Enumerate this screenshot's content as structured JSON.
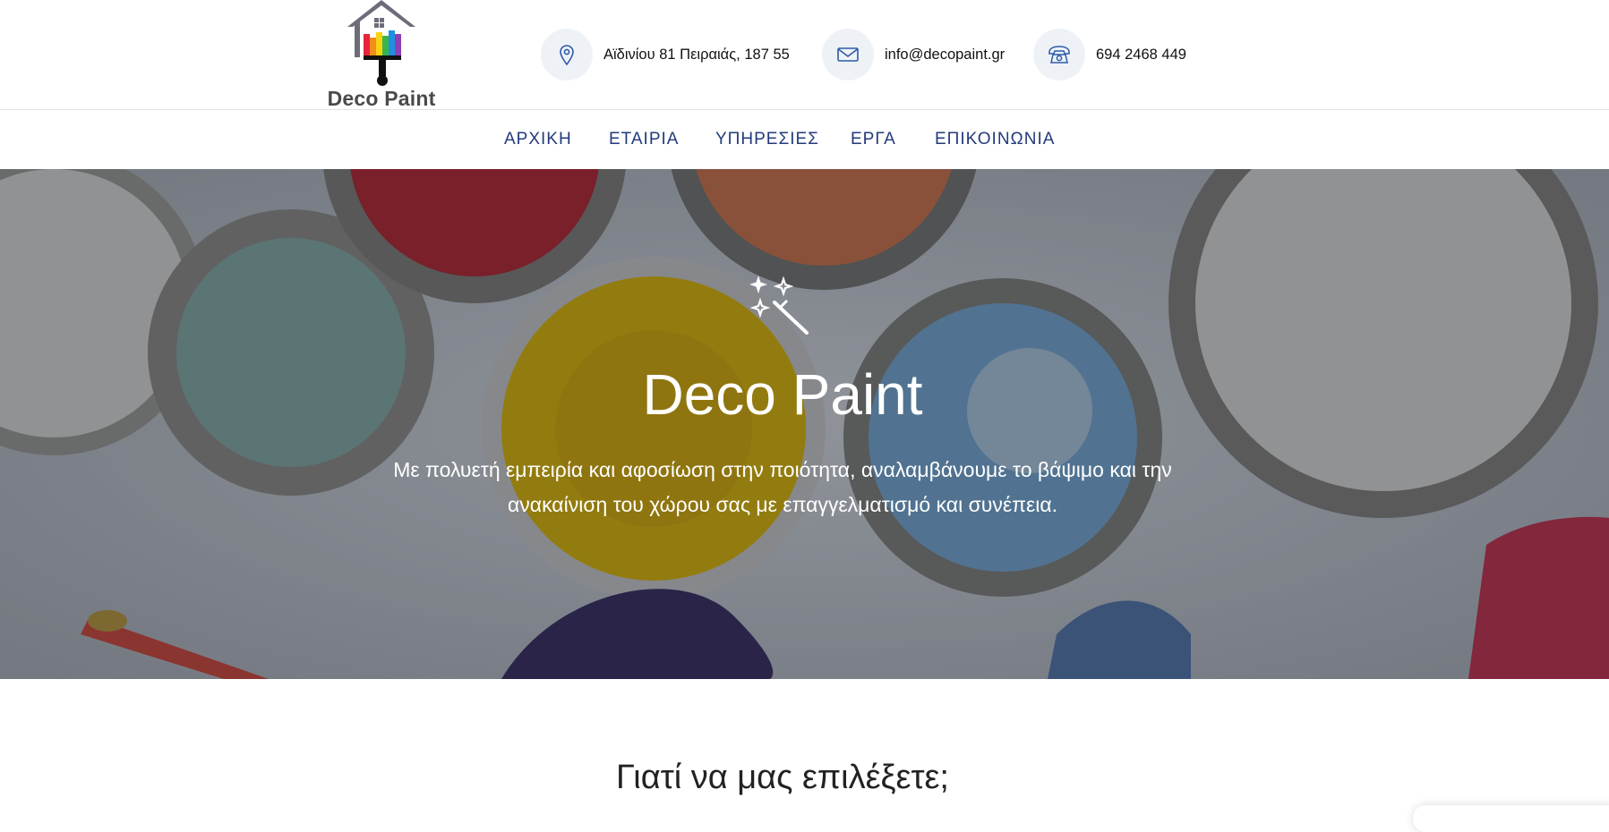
{
  "brand": {
    "name": "Deco Paint"
  },
  "contact": {
    "address": "Αϊδινίου 81 Πειραιάς, 187 55",
    "email": "info@decopaint.gr",
    "phone": "694 2468 449"
  },
  "nav": {
    "items": [
      {
        "label": "ΑΡΧΙΚΗ"
      },
      {
        "label": "ΕΤΑΙΡΙΑ"
      },
      {
        "label": "ΥΠΗΡΕΣΙΕΣ"
      },
      {
        "label": "ΕΡΓΑ"
      },
      {
        "label": "ΕΠΙΚΟΙΝΩΝΙΑ"
      }
    ]
  },
  "hero": {
    "icon": "magic-wand-icon",
    "title": "Deco Paint",
    "subtitle_line1": "Με πολυετή εμπειρία και αφοσίωση στην ποιότητα, αναλαμβάνουμε το βάψιμο και την",
    "subtitle_line2": "ανακαίνιση του χώρου σας με επαγγελματισμό και συνέπεια."
  },
  "section": {
    "title": "Γιατί να μας επιλέξετε;"
  },
  "colors": {
    "nav_text": "#233a7c",
    "icon_blue": "#2f5aa8",
    "icon_circle_bg": "#eef2f7"
  }
}
